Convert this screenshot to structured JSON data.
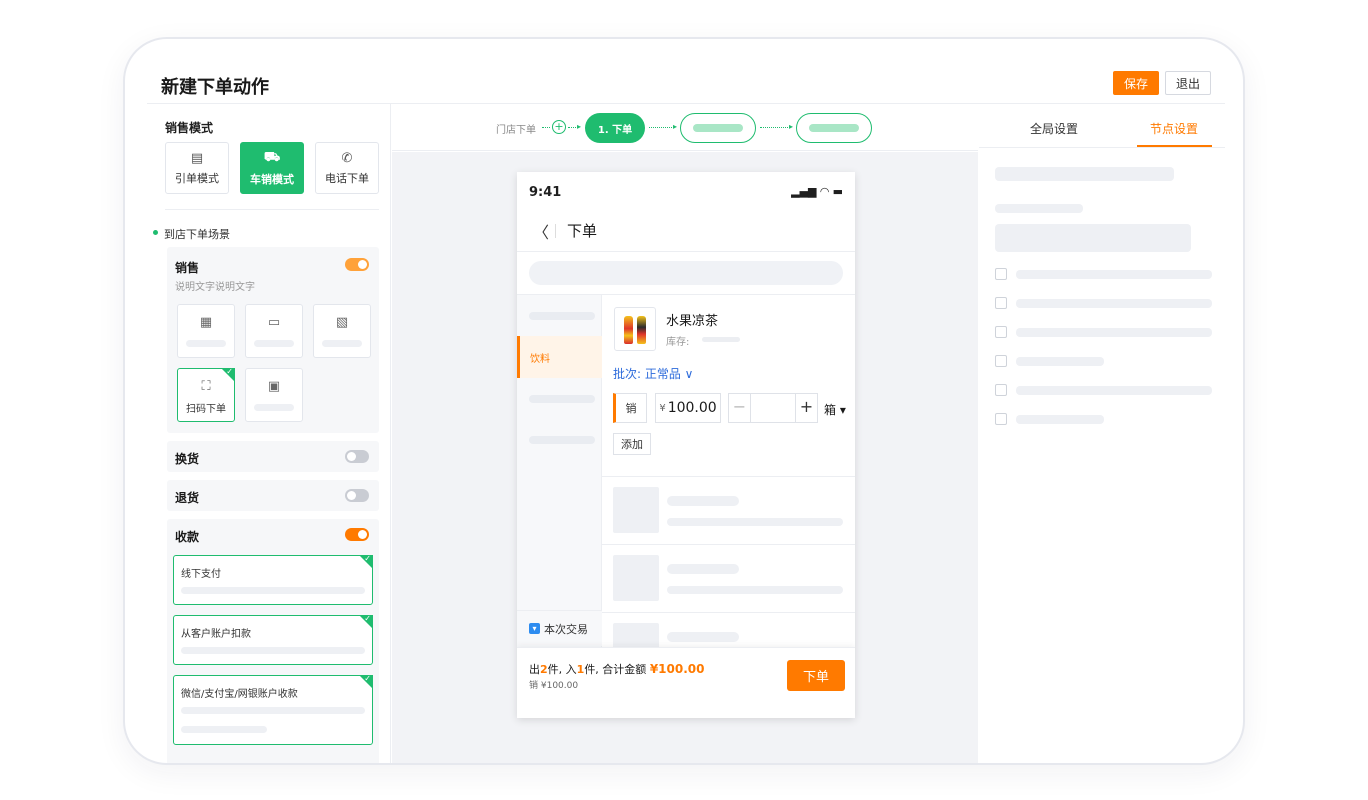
{
  "header": {
    "title": "新建下单动作",
    "save_label": "保存",
    "exit_label": "退出"
  },
  "left": {
    "section_title": "销售模式",
    "modes": [
      {
        "label": "引单模式",
        "icon": "clipboard-icon"
      },
      {
        "label": "车销模式",
        "icon": "truck-icon",
        "active": true
      },
      {
        "label": "电话下单",
        "icon": "phone-icon"
      }
    ],
    "scene_label": "到店下单场景",
    "sale": {
      "title": "销售",
      "desc": "说明文字说明文字",
      "enabled": true,
      "scan_label": "扫码下单"
    },
    "exchange": {
      "title": "换货",
      "enabled": false
    },
    "return": {
      "title": "退货",
      "enabled": false
    },
    "collect": {
      "title": "收款",
      "enabled": true,
      "options": [
        "线下支付",
        "从客户账户扣款",
        "微信/支付宝/网银账户收款"
      ]
    }
  },
  "flow": {
    "start_label": "门店下单",
    "active_step": "1. 下单",
    "accent": "#1fbc6f"
  },
  "phone": {
    "time": "9:41",
    "status_icons": "▂▄▆ ◠ ▬",
    "page_title": "下单",
    "category_active": "饮料",
    "product": {
      "name": "水果凉茶",
      "stock_label": "库存:",
      "batch_label": "批次: 正常品 ∨",
      "sale_tag": "销",
      "price_symbol": "¥",
      "price": "100.00",
      "unit": "箱 ▾",
      "add_label": "添加"
    },
    "transaction_tab": "本次交易",
    "footer": {
      "out_prefix": "出",
      "out_count": "2",
      "out_suffix": "件, 入",
      "in_count": "1",
      "in_suffix": "件, 合计金额 ",
      "total": "¥100.00",
      "sub": "销 ¥100.00",
      "order_button": "下单"
    }
  },
  "right": {
    "tabs": [
      {
        "label": "全局设置",
        "active": false
      },
      {
        "label": "节点设置",
        "active": true
      }
    ]
  },
  "colors": {
    "accent_orange": "#ff7a00",
    "accent_green": "#1fbc6f",
    "link_blue": "#2d6bdb"
  }
}
